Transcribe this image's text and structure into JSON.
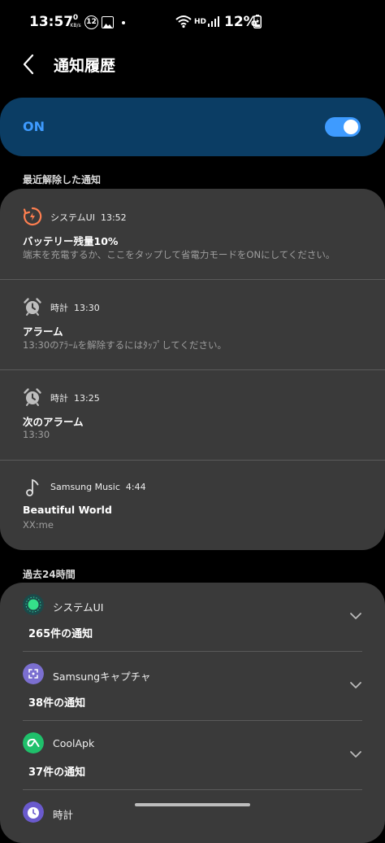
{
  "status_bar": {
    "time": "13:57",
    "net_speed": "0",
    "net_unit": "KB/s",
    "notif_count": "12",
    "network": "HD",
    "battery": "12%"
  },
  "header": {
    "title": "通知履歴"
  },
  "master_toggle": {
    "label": "ON",
    "state": "on"
  },
  "recent": {
    "label": "最近解除した通知",
    "items": [
      {
        "icon": "battery-saver-icon",
        "app": "システムUI",
        "time": "13:52",
        "title": "バッテリー残量10%",
        "body": "端末を充電するか、ここをタップして省電力モードをONにしてください。"
      },
      {
        "icon": "alarm-clock-icon",
        "app": "時計",
        "time": "13:30",
        "title": "アラーム",
        "body": "13:30のｱﾗｰﾑを解除するにはﾀｯﾌﾟしてください。"
      },
      {
        "icon": "alarm-clock-icon",
        "app": "時計",
        "time": "13:25",
        "title": "次のアラーム",
        "body": "13:30"
      },
      {
        "icon": "music-note-icon",
        "app": "Samsung Music",
        "time": "4:44",
        "title": "Beautiful World",
        "body": "XX:me"
      }
    ]
  },
  "past24": {
    "label": "過去24時間",
    "apps": [
      {
        "icon": "system-ui-icon",
        "name": "システムUI",
        "count": "265件の通知"
      },
      {
        "icon": "samsung-capture-icon",
        "name": "Samsungキャプチャ",
        "count": "38件の通知"
      },
      {
        "icon": "coolapk-icon",
        "name": "CoolApk",
        "count": "37件の通知"
      },
      {
        "icon": "clock-app-icon",
        "name": "時計",
        "count": ""
      }
    ]
  },
  "colors": {
    "accent": "#3e9bff",
    "toggle_card": "#0b3d64",
    "card": "#3a3a3a",
    "battery_icon": "#ff7f50",
    "coolapk": "#1fc06b",
    "capture": "#7b6fd0"
  }
}
